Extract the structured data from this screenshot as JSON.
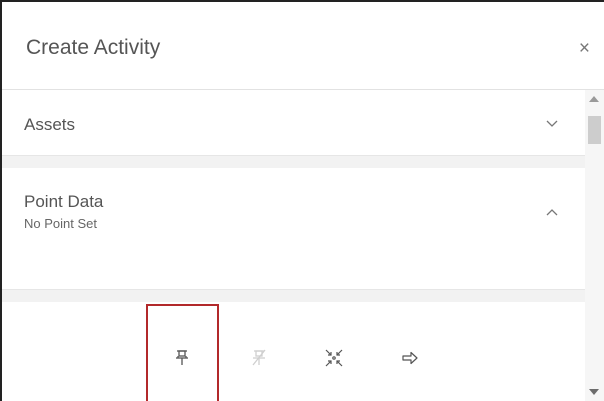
{
  "dialog": {
    "title": "Create Activity",
    "close_glyph": "×"
  },
  "sections": {
    "assets": {
      "label": "Assets",
      "expanded": false
    },
    "point_data": {
      "label": "Point Data",
      "subtitle": "No Point Set",
      "expanded": true
    }
  },
  "toolbar": {
    "tools": [
      {
        "name": "pin-icon",
        "enabled": true,
        "highlighted": true
      },
      {
        "name": "unpin-icon",
        "enabled": false
      },
      {
        "name": "center-icon",
        "enabled": true
      },
      {
        "name": "navigate-arrow-icon",
        "enabled": true
      }
    ]
  },
  "colors": {
    "highlight": "#b2292b",
    "divider_bg": "#f2f2f2",
    "text": "#555555"
  }
}
